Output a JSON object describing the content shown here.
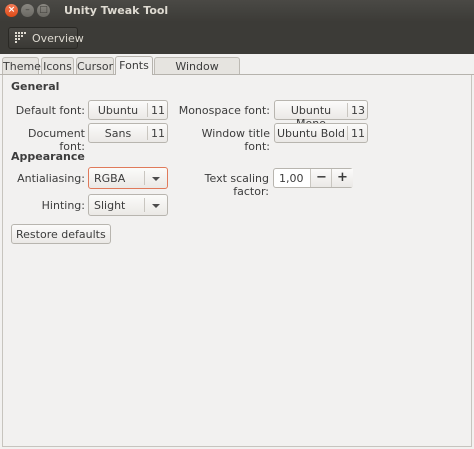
{
  "window": {
    "title": "Unity Tweak Tool",
    "close_glyph": "×",
    "min_glyph": "–",
    "max_glyph": "□"
  },
  "toolbar": {
    "overview_label": "Overview"
  },
  "tabs": [
    {
      "label": "Theme"
    },
    {
      "label": "Icons"
    },
    {
      "label": "Cursor"
    },
    {
      "label": "Fonts",
      "active": true
    },
    {
      "label": "Window Controls"
    }
  ],
  "general": {
    "heading": "General",
    "default_font": {
      "label": "Default font:",
      "name": "Ubuntu",
      "size": "11"
    },
    "monospace_font": {
      "label": "Monospace font:",
      "name": "Ubuntu Mono",
      "size": "13"
    },
    "document_font": {
      "label": "Document font:",
      "name": "Sans",
      "size": "11"
    },
    "window_title_font": {
      "label": "Window title font:",
      "name": "Ubuntu Bold",
      "size": "11"
    }
  },
  "appearance": {
    "heading": "Appearance",
    "antialiasing": {
      "label": "Antialiasing:",
      "value": "RGBA"
    },
    "hinting": {
      "label": "Hinting:",
      "value": "Slight"
    },
    "text_scaling": {
      "label": "Text scaling factor:",
      "value": "1,00",
      "minus": "−",
      "plus": "+"
    }
  },
  "restore_label": "Restore defaults",
  "colors": {
    "titlebar": "#3c3b37",
    "close_button": "#df4a16",
    "focus_border": "#e07a5a",
    "background": "#f2f1f0"
  }
}
